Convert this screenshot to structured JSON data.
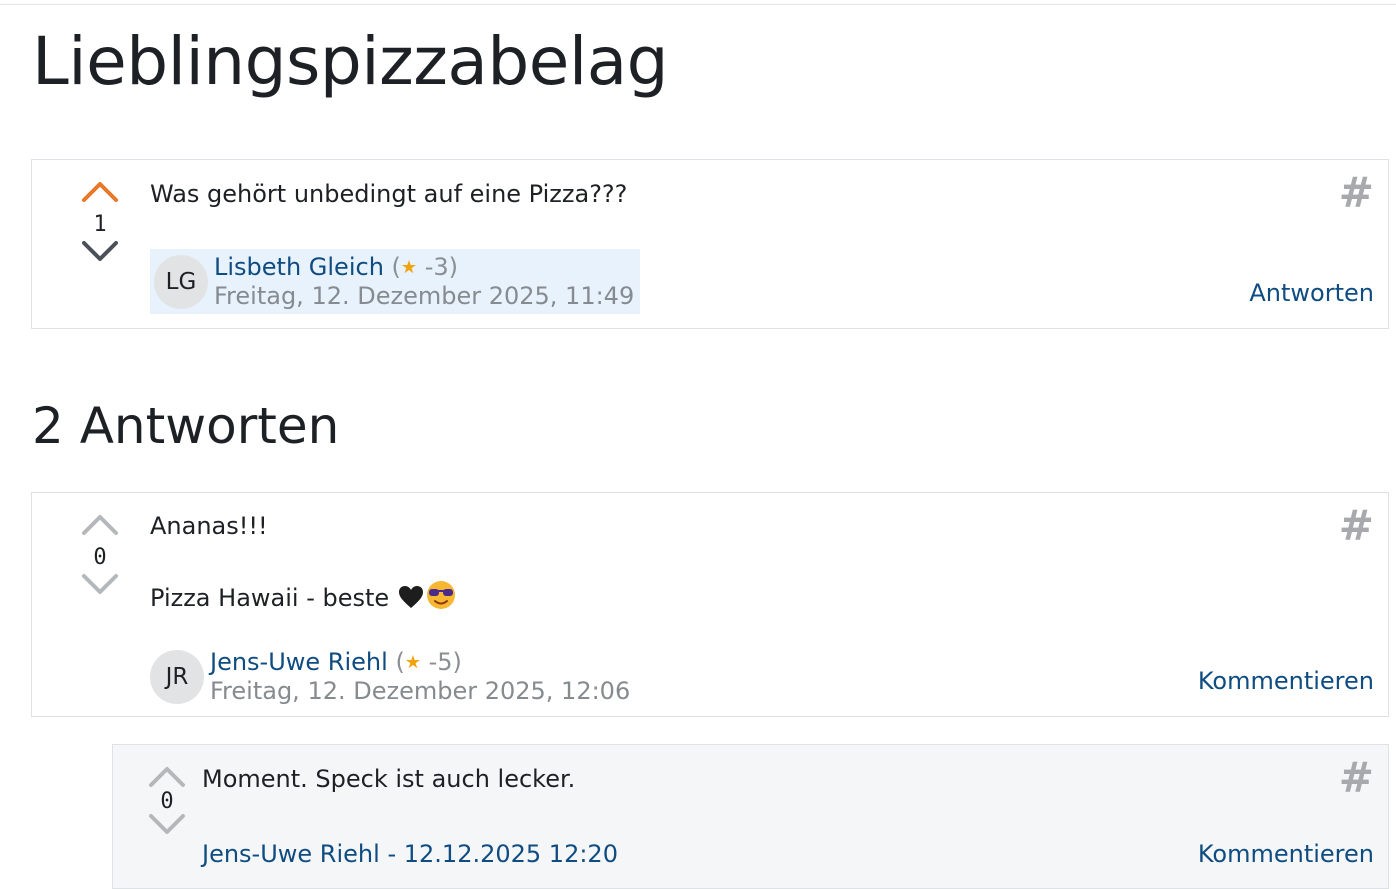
{
  "page_title": "Lieblingspizzabelag",
  "question": {
    "votes": "1",
    "text": "Was gehört unbedingt auf eine Pizza???",
    "author": {
      "initials": "LG",
      "name": "Lisbeth Gleich",
      "rep_open": "(",
      "reputation": "-3)",
      "date": "Freitag, 12. Dezember 2025, 11:49"
    },
    "action": "Antworten",
    "hash": "#"
  },
  "answers_title": "2 Antworten",
  "answer": {
    "votes": "0",
    "line1": "Ananas!!!",
    "line2": "Pizza Hawaii - beste",
    "author": {
      "initials": "JR",
      "name": "Jens-Uwe Riehl",
      "rep_open": "(",
      "reputation": "-5)",
      "date": "Freitag, 12. Dezember 2025, 12:06"
    },
    "action": "Kommentieren",
    "hash": "#"
  },
  "comment": {
    "votes": "0",
    "text": "Moment. Speck ist auch lecker.",
    "author_name": "Jens-Uwe Riehl",
    "separator": "-",
    "date": "12.12.2025 12:20",
    "action": "Kommentieren",
    "hash": "#"
  },
  "colors": {
    "link": "#0f4c81",
    "upvote_active": "#e8782a",
    "star": "#f0a30a",
    "highlight": "#e8f2fc"
  },
  "icons": [
    "chevron-up-icon",
    "chevron-down-icon",
    "star-icon",
    "black-heart-emoji",
    "sunglasses-emoji",
    "hash-icon"
  ]
}
